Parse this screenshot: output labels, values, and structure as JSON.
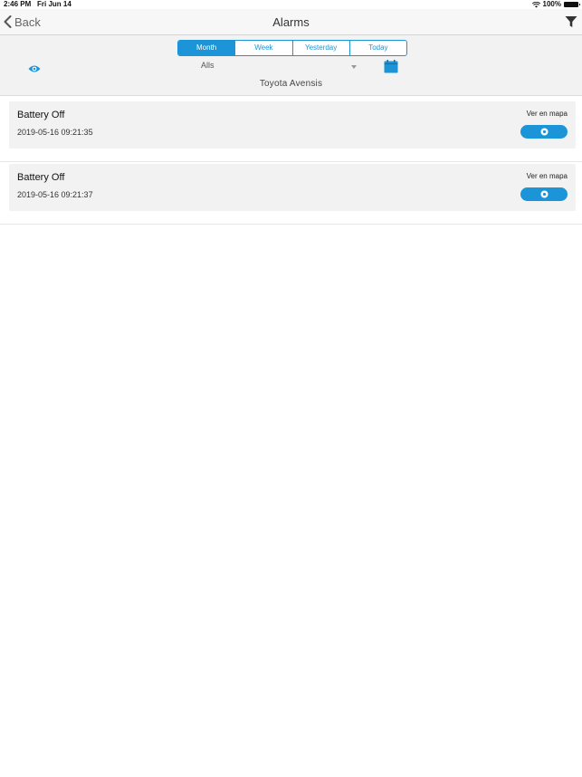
{
  "status_bar": {
    "time": "2:46 PM",
    "date": "Fri Jun 14",
    "battery": "100%"
  },
  "nav": {
    "back_label": "Back",
    "title": "Alarms"
  },
  "period_tabs": [
    {
      "label": "Month",
      "active": true
    },
    {
      "label": "Week",
      "active": false
    },
    {
      "label": "Yesterday",
      "active": false
    },
    {
      "label": "Today",
      "active": false
    }
  ],
  "alarm_type_select": {
    "value": "Alls"
  },
  "vehicle": "Toyota Avensis",
  "alarms": [
    {
      "title": "Battery Off",
      "timestamp": "2019-05-16 09:21:35",
      "map_label": "Ver en mapa"
    },
    {
      "title": "Battery Off",
      "timestamp": "2019-05-16 09:21:37",
      "map_label": "Ver en mapa"
    }
  ],
  "colors": {
    "accent": "#1b95d8",
    "panel": "#f2f2f2",
    "card": "#f2f2f2"
  }
}
